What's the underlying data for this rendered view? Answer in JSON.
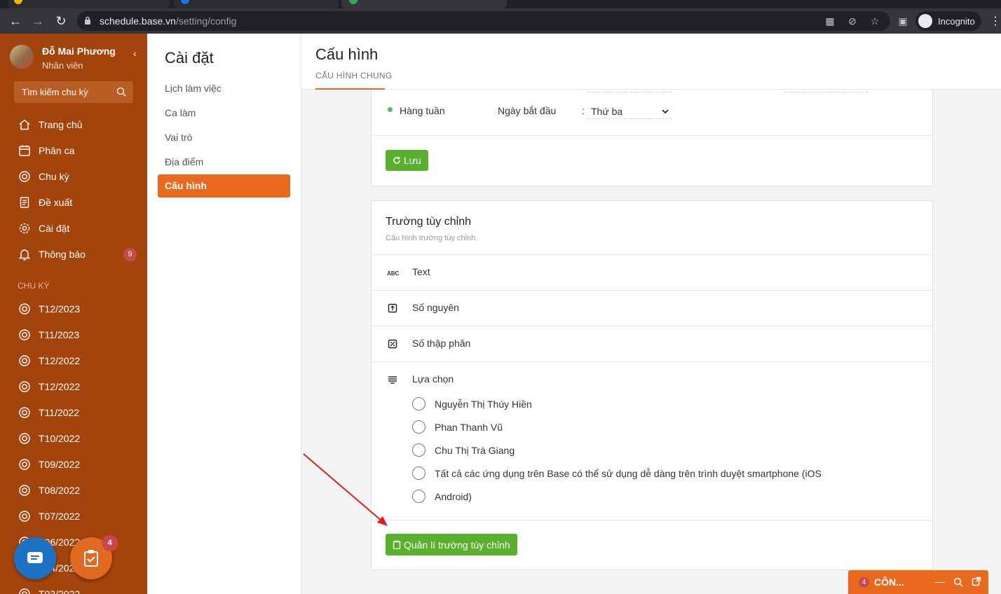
{
  "browser": {
    "url_host": "schedule.base.vn",
    "url_path": "/setting/config",
    "profile_label": "Incognito"
  },
  "sidebar": {
    "user_name": "Đỗ Mai Phương",
    "user_role": "Nhân viên",
    "search_placeholder": "Tìm kiếm chu kỳ",
    "nav": [
      {
        "label": "Trang chủ",
        "icon": "home-icon"
      },
      {
        "label": "Phân ca",
        "icon": "calendar-icon"
      },
      {
        "label": "Chu kỳ",
        "icon": "cycle-icon"
      },
      {
        "label": "Đề xuất",
        "icon": "document-icon"
      },
      {
        "label": "Cài đặt",
        "icon": "gear-icon"
      },
      {
        "label": "Thông báo",
        "icon": "bell-icon"
      }
    ],
    "notification_count": "9",
    "cycles_header": "CHU KỲ",
    "cycles": [
      "T12/2023",
      "T11/2023",
      "T12/2022",
      "T12/2022",
      "T11/2022",
      "T10/2022",
      "T09/2022",
      "T08/2022",
      "T07/2022",
      "T06/2022",
      "T04/2022",
      "T03/2022"
    ],
    "task_badge": "4"
  },
  "settings_menu": {
    "title": "Cài đặt",
    "items": [
      "Lịch làm việc",
      "Ca làm",
      "Vai trò",
      "Địa điểm",
      "Cấu hình"
    ],
    "active_index": 4
  },
  "main": {
    "title": "Cấu hình",
    "tab": "CẤU HÌNH CHUNG",
    "weekly": {
      "label": "Hàng tuần",
      "start_label": "Ngày bắt đầu",
      "colon": ":",
      "start_value": "Thứ ba"
    },
    "save_button": "Lưu",
    "custom_fields": {
      "title": "Trường tùy chỉnh",
      "subtitle": "Cấu hình trường tùy chỉnh.",
      "types": [
        {
          "label": "Text",
          "icon": "text-abc-icon",
          "icon_text": "ABC"
        },
        {
          "label": "Số nguyên",
          "icon": "integer-icon"
        },
        {
          "label": "Số thập phân",
          "icon": "decimal-icon"
        },
        {
          "label": "Lựa chọn",
          "icon": "list-icon"
        }
      ],
      "options": [
        "Nguyễn Thị Thúy Hiền",
        "Phan Thanh Vũ",
        "Chu Thị Trà Giang",
        "Tất cả các ứng dụng trên Base có thể sử dụng dễ dàng trên trình duyệt smartphone (iOS",
        "Android)"
      ],
      "manage_button": "Quản lí trường tùy chỉnh"
    }
  },
  "widget": {
    "badge": "4",
    "label": "CÔN..."
  },
  "colors": {
    "sidebar": "#a3440d",
    "accent": "#e96a1f",
    "green": "#5aaf2c",
    "annotation_arrow": "#e01e1e"
  }
}
